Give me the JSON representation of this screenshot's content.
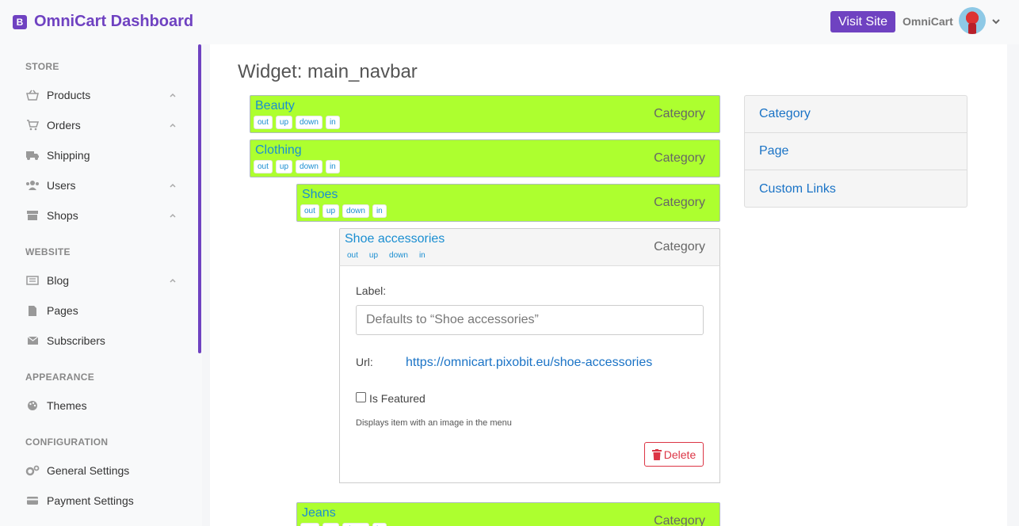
{
  "header": {
    "brand_letter": "B",
    "title": "OmniCart Dashboard",
    "visit_label": "Visit Site",
    "user_name": "OmniCart"
  },
  "sidebar": {
    "sections": {
      "store": "STORE",
      "website": "WEBSITE",
      "appearance": "APPEARANCE",
      "configuration": "CONFIGURATION"
    },
    "items": [
      {
        "label": "Products",
        "icon": "basket-icon"
      },
      {
        "label": "Orders",
        "icon": "cart-icon"
      },
      {
        "label": "Shipping",
        "icon": "truck-icon"
      },
      {
        "label": "Users",
        "icon": "users-icon"
      },
      {
        "label": "Shops",
        "icon": "store-icon"
      },
      {
        "label": "Blog",
        "icon": "newspaper-icon"
      },
      {
        "label": "Pages",
        "icon": "file-icon"
      },
      {
        "label": "Subscribers",
        "icon": "envelope-icon"
      },
      {
        "label": "Themes",
        "icon": "palette-icon"
      },
      {
        "label": "General Settings",
        "icon": "cogs-icon"
      },
      {
        "label": "Payment Settings",
        "icon": "credit-card-icon"
      }
    ]
  },
  "main": {
    "title": "Widget: main_navbar",
    "node_buttons": [
      "out",
      "up",
      "down",
      "in"
    ],
    "nodes": [
      {
        "title": "Beauty",
        "type": "Category"
      },
      {
        "title": "Clothing",
        "type": "Category"
      },
      {
        "title": "Shoes",
        "type": "Category"
      },
      {
        "title": "Shoe accessories",
        "type": "Category"
      },
      {
        "title": "Jeans",
        "type": "Category"
      }
    ],
    "editor": {
      "label_caption": "Label:",
      "label_placeholder": "Defaults to “Shoe accessories”",
      "url_caption": "Url:",
      "url_value": "https://omnicart.pixobit.eu/shoe-accessories",
      "featured_label": "Is Featured",
      "help_text": "Displays item with an image in the menu",
      "delete_label": "Delete"
    },
    "add_types": [
      "Category",
      "Page",
      "Custom Links"
    ]
  },
  "colors": {
    "accent": "#6f42c1",
    "node_bg": "#adff2f",
    "link": "#1a8ed1",
    "danger": "#dc3545"
  }
}
